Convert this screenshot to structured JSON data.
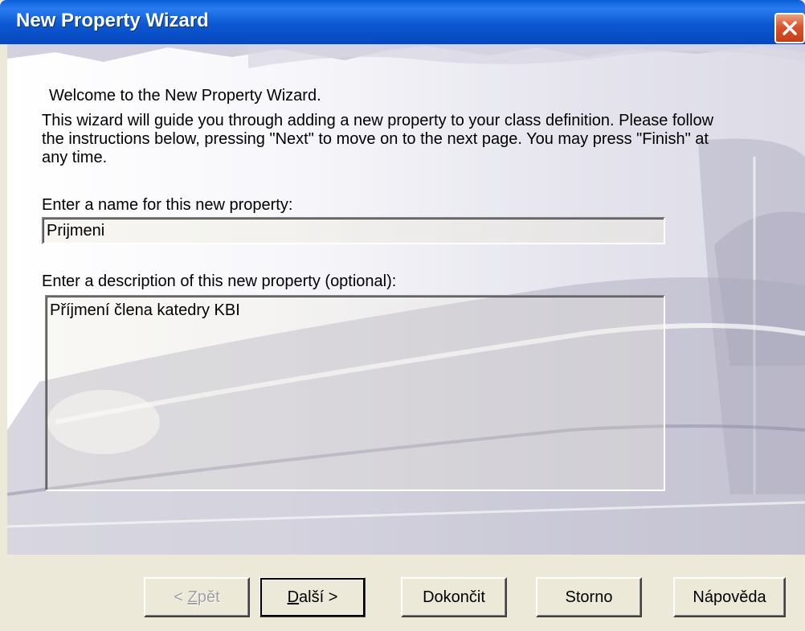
{
  "window": {
    "title": "New Property Wizard"
  },
  "content": {
    "welcome": "Welcome to the New Property Wizard.",
    "intro_line1": "This wizard will guide you through adding a new property to your class definition. Please follow",
    "intro_line2": "the instructions below, pressing \"Next\" to move on to the next page. You may press \"Finish\" at",
    "intro_line3": "any time.",
    "name_label": "Enter a name for this new property:",
    "name_value": "Prijmeni",
    "desc_label": "Enter a description of this new property (optional):",
    "desc_value": "Příjmení člena katedry KBI"
  },
  "buttons": {
    "back_prefix": "< ",
    "back_underlined": "Z",
    "back_rest": "pět",
    "next_underlined": "D",
    "next_rest": "alší >",
    "finish": "Dokončit",
    "cancel": "Storno",
    "help": "Nápověda"
  }
}
